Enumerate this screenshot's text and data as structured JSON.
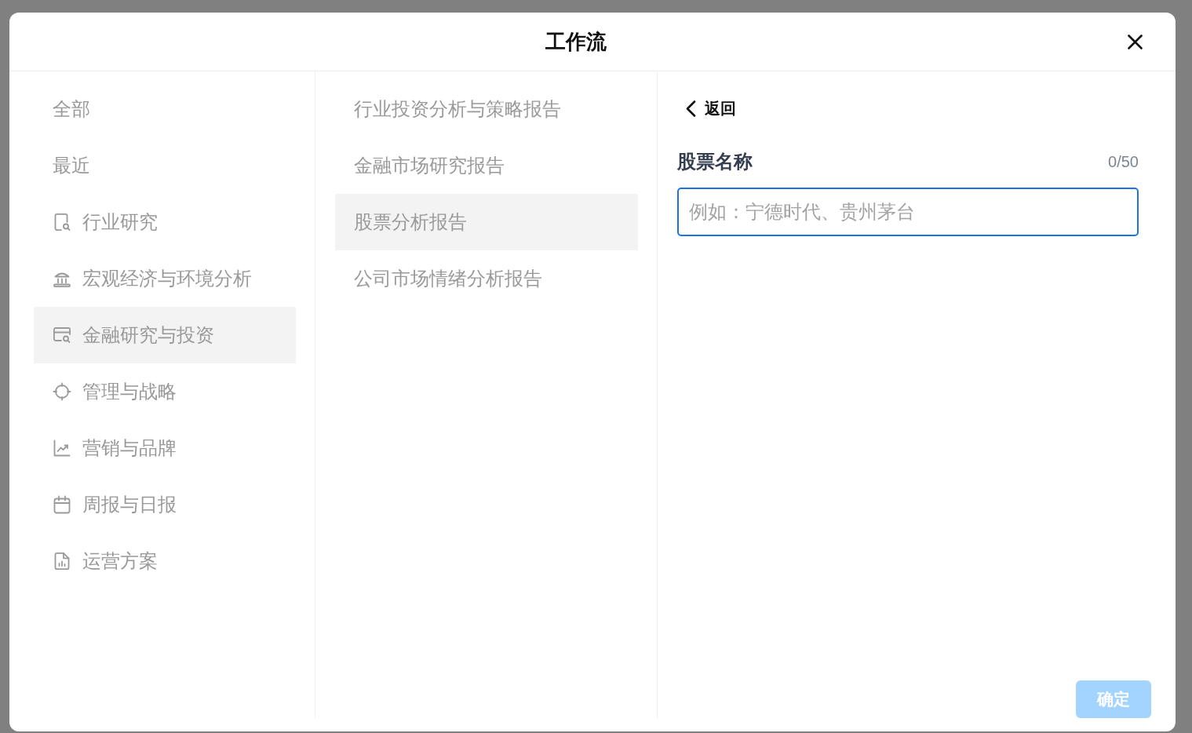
{
  "dialog": {
    "title": "工作流"
  },
  "categories": [
    {
      "label": "全部",
      "kind": "all",
      "selected": false
    },
    {
      "label": "最近",
      "kind": "recent",
      "selected": false
    },
    {
      "label": "行业研究",
      "kind": "industry",
      "selected": false
    },
    {
      "label": "宏观经济与环境分析",
      "kind": "macro",
      "selected": false
    },
    {
      "label": "金融研究与投资",
      "kind": "finance",
      "selected": true
    },
    {
      "label": "管理与战略",
      "kind": "management",
      "selected": false
    },
    {
      "label": "营销与品牌",
      "kind": "marketing",
      "selected": false
    },
    {
      "label": "周报与日报",
      "kind": "reports",
      "selected": false
    },
    {
      "label": "运营方案",
      "kind": "operations",
      "selected": false
    }
  ],
  "templates": [
    {
      "label": "行业投资分析与策略报告",
      "selected": false
    },
    {
      "label": "金融市场研究报告",
      "selected": false
    },
    {
      "label": "股票分析报告",
      "selected": true
    },
    {
      "label": "公司市场情绪分析报告",
      "selected": false
    }
  ],
  "form": {
    "back_label": "返回",
    "field": {
      "label": "股票名称",
      "counter": "0/50",
      "placeholder": "例如：宁德时代、贵州茅台",
      "focused": true
    },
    "confirm_button": {
      "label": "确定",
      "disabled": true
    }
  }
}
